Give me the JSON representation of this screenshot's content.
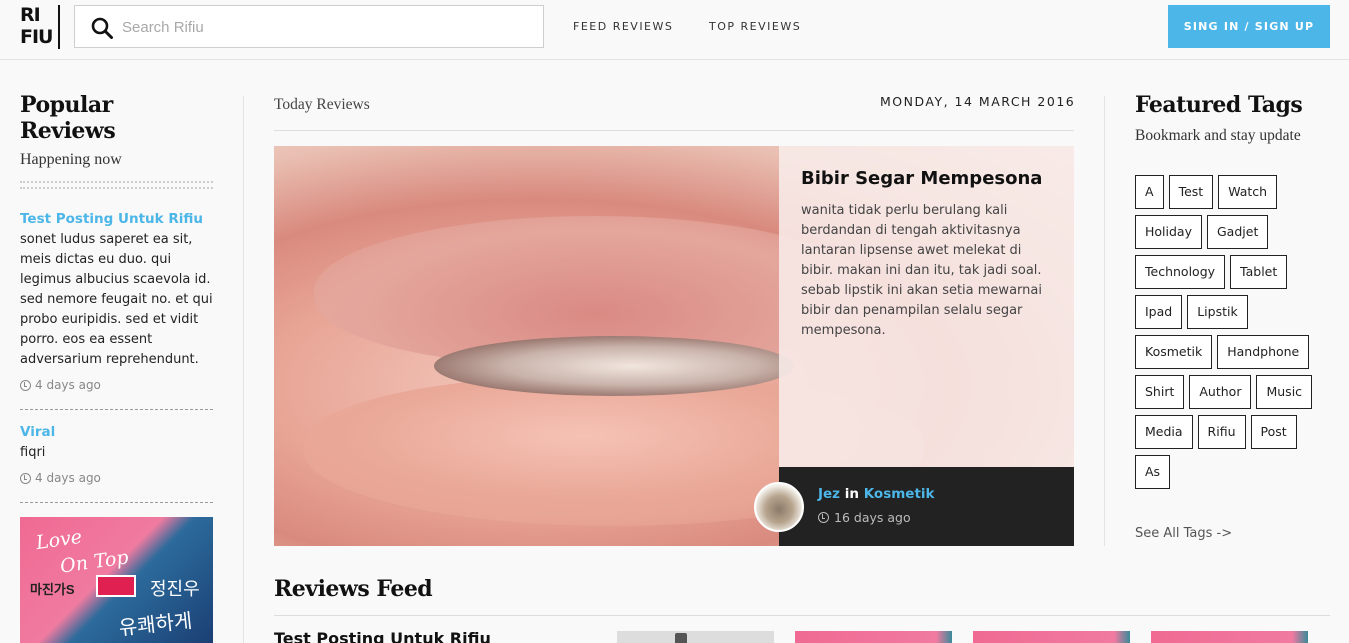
{
  "header": {
    "logo_line1": "RI",
    "logo_line2": "FIU",
    "search_placeholder": "Search Rifiu",
    "nav": [
      "FEED REVIEWS",
      "TOP REVIEWS"
    ],
    "signin_label": "SING IN / SIGN UP",
    "accent_color": "#4cb6e8"
  },
  "popular": {
    "title": "Popular Reviews",
    "subtitle": "Happening now",
    "posts": [
      {
        "title": "Test Posting Untuk Rifiu",
        "body": "sonet ludus saperet ea sit, meis dictas eu duo. qui legimus albucius scaevola id. sed nemore feugait no. et qui probo euripidis. sed et vidit porro. eos ea essent adversarium reprehendunt.",
        "time": "4 days ago"
      },
      {
        "title": "Viral",
        "body": "fiqri",
        "time": "4 days ago"
      }
    ],
    "album": {
      "title_line1": "Love",
      "title_line2": "On Top",
      "korean1": "마진가S",
      "korean2": "정진우",
      "korean3": "유쾌하게 살자"
    }
  },
  "main": {
    "section_label": "Today Reviews",
    "date": "MONDAY, 14 MARCH 2016",
    "featured": {
      "title": "Bibir Segar Mempesona",
      "text": "wanita tidak perlu berulang kali berdandan di tengah aktivitasnya lantaran lipsense awet melekat di bibir. makan ini dan itu, tak jadi soal. sebab lipstik ini akan setia mewarnai bibir dan penampilan selalu segar mempesona.",
      "author": "Jez",
      "in_word": "in",
      "category": "Kosmetik",
      "time": "16 days ago"
    },
    "feed": {
      "title": "Reviews Feed",
      "first_post": "Test Posting Untuk Rifiu"
    }
  },
  "featured_tags": {
    "title": "Featured Tags",
    "subtitle": "Bookmark and stay update",
    "rows": [
      [
        "A",
        "Test",
        "Watch"
      ],
      [
        "Holiday",
        "Gadjet"
      ],
      [
        "Technology",
        "Tablet"
      ],
      [
        "Ipad",
        "Lipstik"
      ],
      [
        "Kosmetik",
        "Handphone"
      ],
      [
        "Shirt",
        "Author",
        "Music"
      ],
      [
        "Media",
        "Rifiu",
        "Post"
      ],
      [
        "As"
      ]
    ],
    "see_all": "See All Tags ->"
  }
}
